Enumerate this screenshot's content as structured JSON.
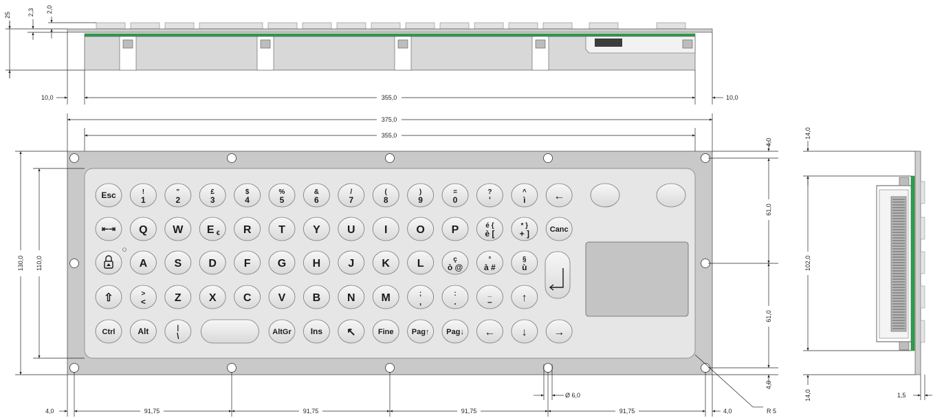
{
  "dimensions": {
    "top_left_h": "25",
    "top_left_a": "2,3",
    "top_left_b": "2,0",
    "side_margin_left": "10,0",
    "side_margin_right": "10,0",
    "inner_width_top": "355,0",
    "overall_width": "375,0",
    "inner_width_mid": "355,0",
    "overall_height": "130,0",
    "inner_height": "110,0",
    "right_top_offset": "4,0",
    "right_upper_pitch": "61,0",
    "right_lower_pitch": "61,0",
    "right_bottom_offset": "4,0",
    "bottom_left_offset": "4,0",
    "hole_pitch_1": "91,75",
    "hole_pitch_2": "91,75",
    "hole_pitch_3": "91,75",
    "hole_pitch_4": "91,75",
    "bottom_right_offset": "4,0",
    "hole_diameter": "Ø 6,0",
    "corner_radius": "R 5",
    "side_top": "14,0",
    "side_height": "102,0",
    "side_bottom": "14,0",
    "side_thickness": "1,5"
  },
  "keys": {
    "row1": [
      {
        "t": "Esc"
      },
      {
        "t": "!",
        "b": "1"
      },
      {
        "t": "\"",
        "b": "2"
      },
      {
        "t": "£",
        "b": "3"
      },
      {
        "t": "$",
        "b": "4"
      },
      {
        "t": "%",
        "b": "5"
      },
      {
        "t": "&",
        "b": "6"
      },
      {
        "t": "/",
        "b": "7"
      },
      {
        "t": "(",
        "b": "8"
      },
      {
        "t": ")",
        "b": "9"
      },
      {
        "t": "=",
        "b": "0"
      },
      {
        "t": "?",
        "b": "'"
      },
      {
        "t": "^",
        "b": "ì"
      },
      {
        "t": "←"
      }
    ],
    "row2": [
      {
        "t": "⇤⇥"
      },
      {
        "t": "Q"
      },
      {
        "t": "W"
      },
      {
        "t": "E",
        "s": "€"
      },
      {
        "t": "R"
      },
      {
        "t": "T"
      },
      {
        "t": "Y"
      },
      {
        "t": "U"
      },
      {
        "t": "I"
      },
      {
        "t": "O"
      },
      {
        "t": "P"
      },
      {
        "t": "é {",
        "b": "è ["
      },
      {
        "t": "* }",
        "b": "+ ]"
      },
      {
        "t": "Canc"
      }
    ],
    "row3": [
      {
        "t": "lock"
      },
      {
        "t": "A"
      },
      {
        "t": "S"
      },
      {
        "t": "D"
      },
      {
        "t": "F"
      },
      {
        "t": "G"
      },
      {
        "t": "H"
      },
      {
        "t": "J"
      },
      {
        "t": "K"
      },
      {
        "t": "L"
      },
      {
        "t": "ç",
        "b": "ò @"
      },
      {
        "t": "°",
        "b": "à #"
      },
      {
        "t": "§",
        "b": "ù"
      }
    ],
    "row4": [
      {
        "t": "⇧"
      },
      {
        "t": ">",
        "b": "<"
      },
      {
        "t": "Z"
      },
      {
        "t": "X"
      },
      {
        "t": "C"
      },
      {
        "t": "V"
      },
      {
        "t": "B"
      },
      {
        "t": "N"
      },
      {
        "t": "M"
      },
      {
        "t": ";",
        "b": ","
      },
      {
        "t": ":",
        "b": "."
      },
      {
        "t": "_",
        "b": "–"
      },
      {
        "t": "↑"
      }
    ],
    "row5": [
      {
        "t": "Ctrl"
      },
      {
        "t": "Alt"
      },
      {
        "t": "|",
        "b": "\\"
      },
      {
        "t": "space"
      },
      {
        "t": "AltGr"
      },
      {
        "t": "Ins"
      },
      {
        "t": "↖"
      },
      {
        "t": "Fine"
      },
      {
        "t": "Pag↑"
      },
      {
        "t": "Pag↓"
      },
      {
        "t": "←"
      },
      {
        "t": "↓"
      },
      {
        "t": "→"
      }
    ]
  },
  "colors": {
    "panel": "#c9c9c9",
    "panel_stroke": "#555555",
    "keyboard_face": "#e6e6e6",
    "key_fill": "#ececec",
    "touchpad": "#c4c4c4",
    "pcb": "#2e9e4a"
  }
}
